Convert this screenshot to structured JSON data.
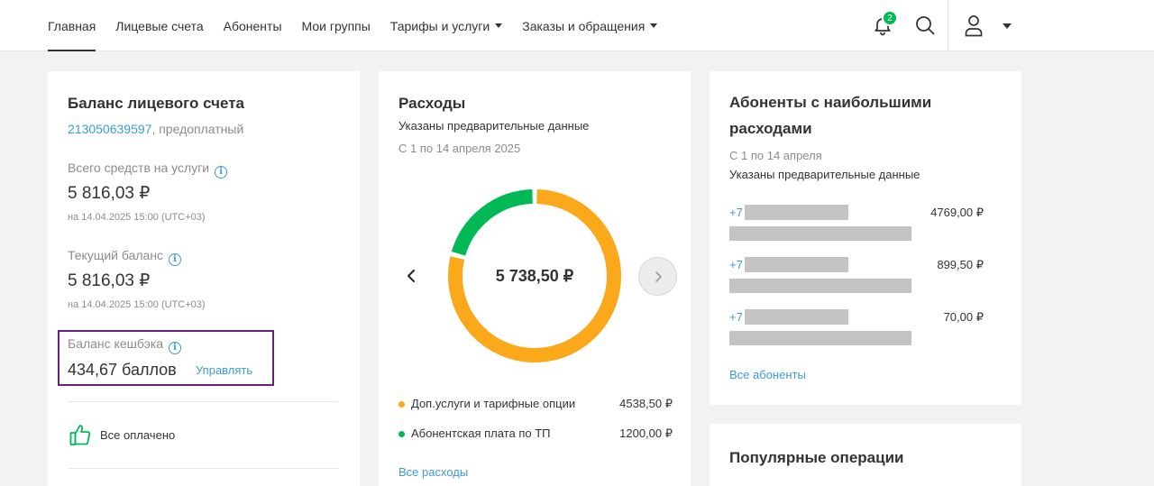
{
  "nav": {
    "items": [
      "Главная",
      "Лицевые счета",
      "Абоненты",
      "Мои группы",
      "Тарифы и услуги",
      "Заказы и обращения"
    ],
    "notifications_count": "2"
  },
  "balance": {
    "title": "Баланс лицевого счета",
    "account_number": "213050639597",
    "account_type": ", предоплатный",
    "total_label": "Всего средств на услуги",
    "total_value": "5 816,03 ₽",
    "total_date": "на 14.04.2025 15:00 (UTC+03)",
    "current_label": "Текущий баланс",
    "current_value": "5 816,03 ₽",
    "current_date": "на 14.04.2025 15:00 (UTC+03)",
    "cashback_label": "Баланс кешбэка",
    "cashback_value": "434,67 баллов",
    "cashback_manage": "Управлять",
    "paid_status": "Все оплачено"
  },
  "expenses": {
    "title": "Расходы",
    "subtitle": "Указаны предварительные данные",
    "period": "С 1 по 14 апреля 2025",
    "total": "5 738,50 ₽",
    "items": [
      {
        "label": "Доп.услуги и тарифные опции",
        "value": "4538,50 ₽",
        "amount": 4538.5,
        "color": "#fba81b"
      },
      {
        "label": "Абонентская плата по ТП",
        "value": "1200,00 ₽",
        "amount": 1200.0,
        "color": "#00b956"
      }
    ],
    "all_link": "Все расходы"
  },
  "top_subscribers": {
    "title": "Абоненты с наибольшими расходами",
    "period": "С 1 по 14 апреля",
    "subtitle": "Указаны предварительные данные",
    "rows": [
      {
        "phone_prefix": "+7",
        "amount": "4769,00 ₽"
      },
      {
        "phone_prefix": "+7",
        "amount": "899,50 ₽"
      },
      {
        "phone_prefix": "+7",
        "amount": "70,00 ₽"
      }
    ],
    "all_link": "Все абоненты"
  },
  "popular": {
    "title": "Популярные операции"
  },
  "colors": {
    "accent_green": "#00b956",
    "accent_orange": "#fba81b",
    "link_blue": "#3a9bd9",
    "highlight_purple": "#6b1e78"
  }
}
